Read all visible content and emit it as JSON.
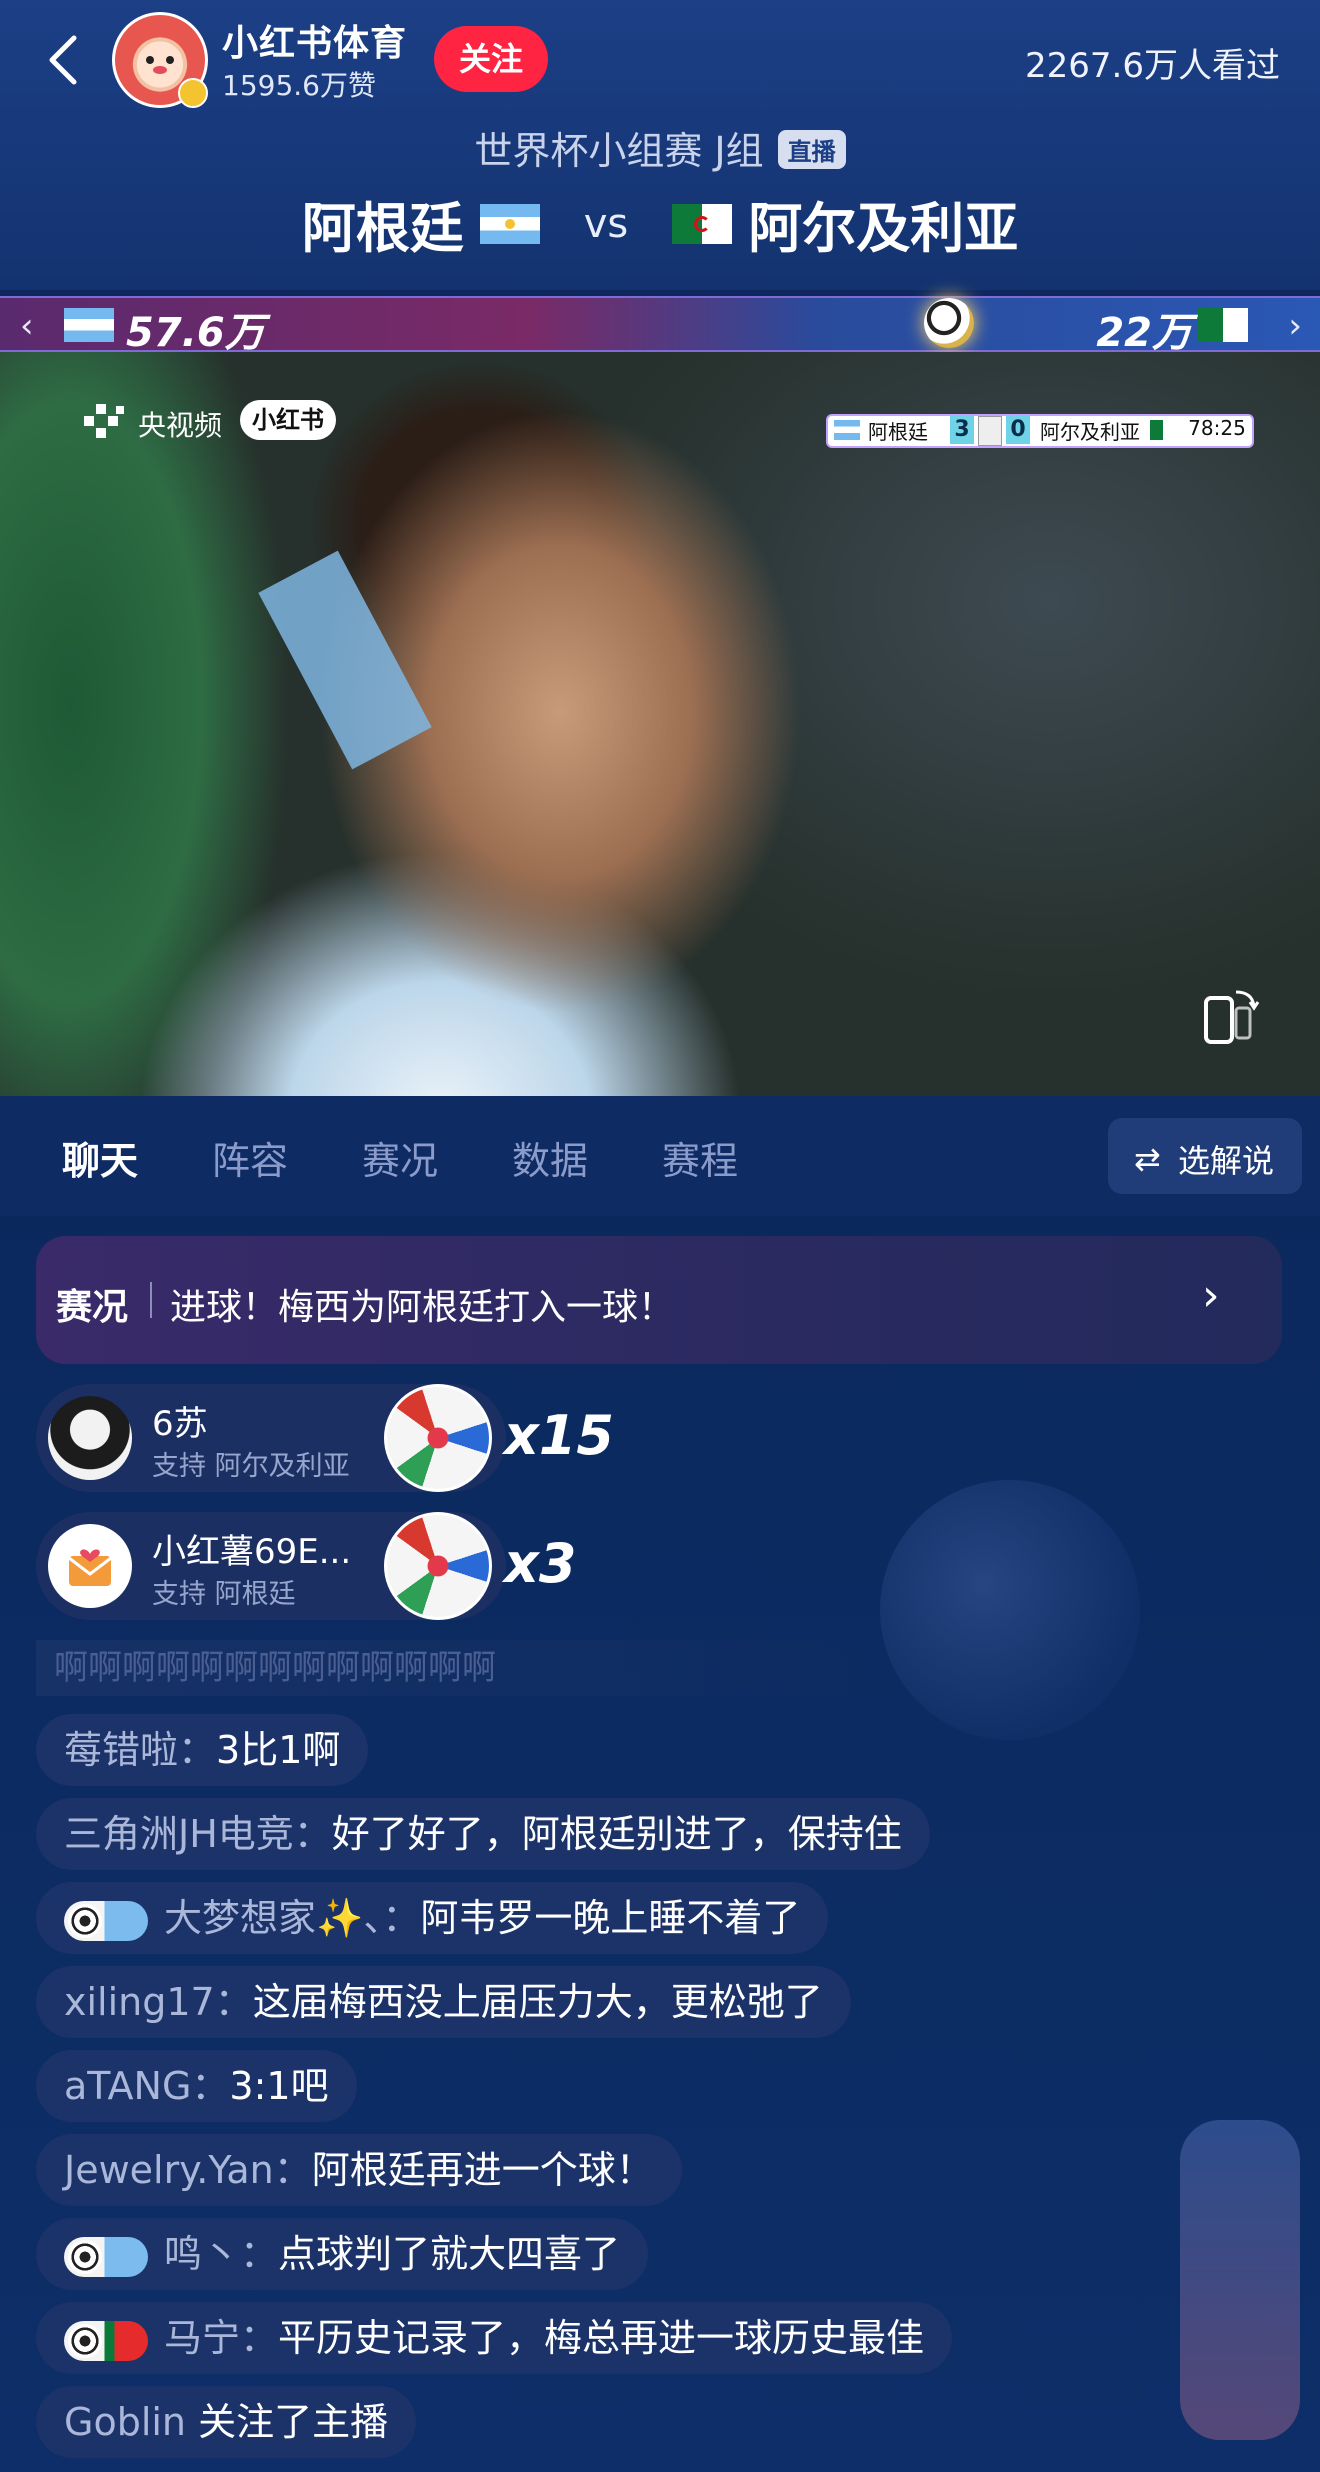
{
  "header": {
    "channel_name": "小红书体育",
    "likes": "1595.6万赞",
    "follow_label": "关注",
    "viewers": "2267.6万人看过",
    "competition": "世界杯小组赛 J组",
    "live_tag": "直播",
    "home_team": "阿根廷",
    "vs": "vs",
    "away_team": "阿尔及利亚"
  },
  "support_bar": {
    "left_value": "57.6万",
    "right_value": "22万",
    "left_arrow": "‹",
    "right_arrow": "›"
  },
  "video": {
    "broadcaster": "央视频",
    "platform_logo": "小红书",
    "scoreboard": {
      "home": "阿根廷",
      "home_score": "3",
      "away_score": "0",
      "away": "阿尔及利亚",
      "time": "78:25"
    }
  },
  "tabs": [
    {
      "label": "聊天",
      "active": true
    },
    {
      "label": "阵容"
    },
    {
      "label": "赛况"
    },
    {
      "label": "数据"
    },
    {
      "label": "赛程"
    }
  ],
  "commentary_button": {
    "icon": "⇄",
    "label": "选解说"
  },
  "banner": {
    "tag": "赛况",
    "text": "进球！梅西为阿根廷打入一球！",
    "arrow": "›"
  },
  "gifts": [
    {
      "name": "6苏",
      "support": "支持 阿尔及利亚",
      "count": "x15"
    },
    {
      "name": "小红薯69E...",
      "support": "支持 阿根廷",
      "count": "x3"
    }
  ],
  "marquee": "啊啊啊啊啊啊啊啊啊啊啊啊啊",
  "chat": [
    {
      "user": "莓错啦：",
      "message": "3比1啊"
    },
    {
      "user": "三角洲JH电竞：",
      "message": "好了好了，阿根廷别进了，保持住"
    },
    {
      "user": "大梦想家✨、：",
      "message": "阿韦罗一晚上睡不着了",
      "badge": "argentina"
    },
    {
      "user": "xiling17：",
      "message": "这届梅西没上届压力大，更松弛了"
    },
    {
      "user": "aTANG：",
      "message": "3:1吧"
    },
    {
      "user": "Jewelry.Yan：",
      "message": "阿根廷再进一个球！"
    },
    {
      "user": "鸣丶：",
      "message": "点球判了就大四喜了",
      "badge": "argentina"
    },
    {
      "user": "马宁：",
      "message": "平历史记录了，梅总再进一球历史最佳",
      "badge": "portugal"
    },
    {
      "user": "Goblin",
      "message": "关注了主播"
    }
  ],
  "colors": {
    "background": "#0c2658",
    "follow_red": "#ff2442",
    "tab_inactive": "#8b9ccb",
    "chat_pill": "#1c3369"
  }
}
